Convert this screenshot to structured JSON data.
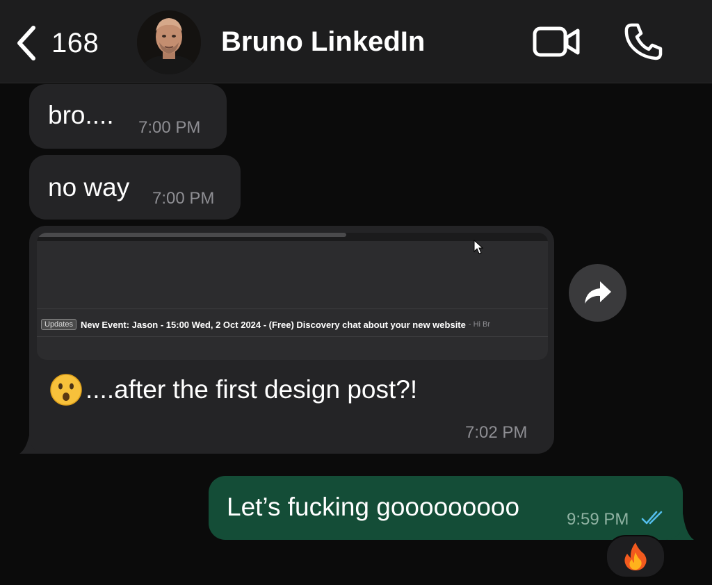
{
  "header": {
    "back_count": "168",
    "contact_name": "Bruno LinkedIn"
  },
  "messages": [
    {
      "direction": "incoming",
      "text": "bro....",
      "time": "7:00 PM"
    },
    {
      "direction": "incoming",
      "text": "no way",
      "time": "7:00 PM"
    },
    {
      "direction": "incoming",
      "link_preview": {
        "badge": "Updates",
        "subject": "New Event: Jason - 15:00 Wed, 2 Oct 2024 - (Free) Discovery chat about your new website",
        "snippet": "- Hi Br"
      },
      "text": "....after the first design post?!",
      "time": "7:02 PM"
    },
    {
      "direction": "outgoing",
      "text": "Let’s fucking gooooooooo",
      "time": "9:59 PM",
      "status": "read",
      "reaction": "🔥"
    }
  ],
  "colors": {
    "header_bg": "#1d1d1e",
    "incoming_bubble": "#242426",
    "outgoing_bubble": "#144d37",
    "read_receipt": "#53bdeb",
    "timestamp": "#8e8e93",
    "background": "#0b0b0b"
  },
  "icons": {
    "back": "chevron-left-icon",
    "video": "video-camera-icon",
    "phone": "phone-icon",
    "forward": "forward-arrow-icon",
    "read": "double-check-icon",
    "cursor": "mouse-pointer-icon"
  }
}
